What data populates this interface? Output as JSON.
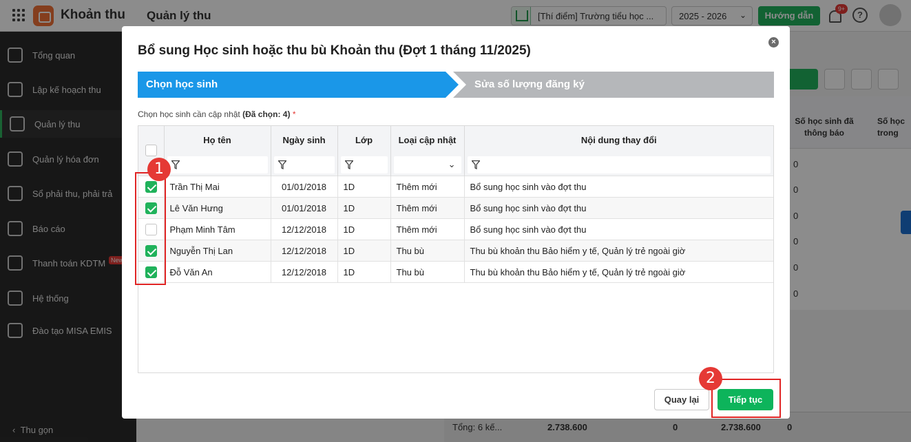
{
  "app": {
    "name": "Khoản thu",
    "module": "Quản lý thu",
    "school": "[Thí điểm] Trường tiểu học ...",
    "school_year": "2025 - 2026",
    "guide_label": "Hướng dẫn",
    "notif_count": "9+",
    "help": "?"
  },
  "sidebar": {
    "items": [
      {
        "label": "Tổng quan",
        "icon": "chart-icon"
      },
      {
        "label": "Lập kế hoạch thu",
        "icon": "calendar-icon"
      },
      {
        "label": "Quản lý thu",
        "icon": "money-hand-icon"
      },
      {
        "label": "Quản lý hóa đơn",
        "icon": "invoice-icon"
      },
      {
        "label": "Sổ phải thu, phải trả",
        "icon": "ledger-icon"
      },
      {
        "label": "Báo cáo",
        "icon": "pie-chart-icon"
      },
      {
        "label": "Thanh toán KDTM",
        "icon": "card-icon",
        "badge": "New"
      },
      {
        "label": "Hệ thống",
        "icon": "gear-icon"
      },
      {
        "label": "Đào tạo MISA EMIS",
        "icon": "book-icon"
      }
    ],
    "collapse_label": "Thu gọn"
  },
  "background": {
    "col_header_1": "Số học sinh đã thông báo",
    "col_header_2": "Số học trong",
    "zero": "0",
    "footer_total_label": "Tổng: 6 kế...",
    "footer_amount_1": "2.738.600",
    "footer_zero_1": "0",
    "footer_amount_2": "2.738.600",
    "footer_zero_2": "0"
  },
  "dialog": {
    "title": "Bổ sung Học sinh hoặc thu bù Khoản thu (Đợt 1 tháng 11/2025)",
    "close_icon": "×",
    "steps": [
      "Chọn học sinh",
      "Sửa số lượng đăng ký"
    ],
    "select_label": "Chọn học sinh cần cập nhật",
    "selected_count": "(Đã chọn: 4)",
    "required_mark": "*",
    "columns": [
      "Họ tên",
      "Ngày sinh",
      "Lớp",
      "Loại cập nhật",
      "Nội dung thay đổi"
    ],
    "rows": [
      {
        "checked": true,
        "name": "Trần Thị Mai",
        "dob": "01/01/2018",
        "class": "1D",
        "type": "Thêm mới",
        "content": "Bổ sung học sinh vào đợt thu"
      },
      {
        "checked": true,
        "name": "Lê Văn Hưng",
        "dob": "01/01/2018",
        "class": "1D",
        "type": "Thêm mới",
        "content": "Bổ sung học sinh vào đợt thu"
      },
      {
        "checked": false,
        "name": "Phạm Minh Tâm",
        "dob": "12/12/2018",
        "class": "1D",
        "type": "Thêm mới",
        "content": "Bổ sung học sinh vào đợt thu"
      },
      {
        "checked": true,
        "name": "Nguyễn Thị Lan",
        "dob": "12/12/2018",
        "class": "1D",
        "type": "Thu bù",
        "content": "Thu bù khoản thu Bảo hiểm y tế, Quản lý trẻ ngoài giờ"
      },
      {
        "checked": true,
        "name": "Đỗ Văn An",
        "dob": "12/12/2018",
        "class": "1D",
        "type": "Thu bù",
        "content": "Thu bù khoản thu Bảo hiểm y tế, Quản lý trẻ ngoài giờ"
      }
    ],
    "back_label": "Quay lại",
    "next_label": "Tiếp tục"
  },
  "annotations": {
    "marker_1": "1",
    "marker_2": "2"
  },
  "colors": {
    "primary_green": "#0db45b",
    "step_active": "#1a97e8",
    "step_inactive": "#b5b7ba",
    "highlight_red": "#e02424"
  }
}
